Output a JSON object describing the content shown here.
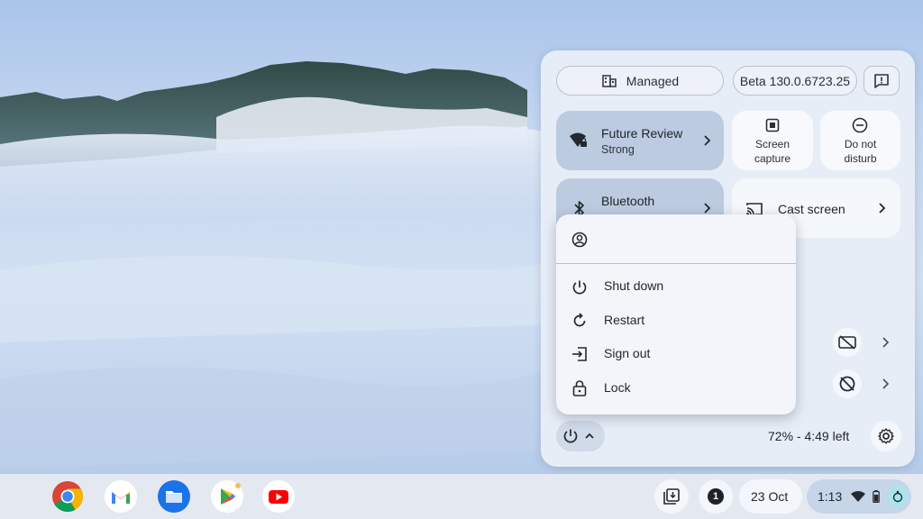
{
  "quick_settings": {
    "managed_label": "Managed",
    "version_label": "Beta 130.0.6723.25",
    "network": {
      "title": "Future Review",
      "subtitle": "Strong"
    },
    "bluetooth": {
      "title": "Bluetooth"
    },
    "screen_capture_label_1": "Screen",
    "screen_capture_label_2": "capture",
    "dnd_label_1": "Do not",
    "dnd_label_2": "disturb",
    "cast_label": "Cast screen",
    "battery_label": "72% - 4:49 left"
  },
  "power_menu": {
    "items": [
      {
        "label": "Shut down"
      },
      {
        "label": "Restart"
      },
      {
        "label": "Sign out"
      },
      {
        "label": "Lock"
      }
    ]
  },
  "shelf": {
    "apps": [
      "Chrome",
      "Gmail",
      "Files",
      "Play Store",
      "YouTube"
    ],
    "notification_count": "1",
    "date": "23 Oct",
    "time": "1:13"
  },
  "colors": {
    "accent": "#bccbdf",
    "panel": "#e7edf7"
  }
}
